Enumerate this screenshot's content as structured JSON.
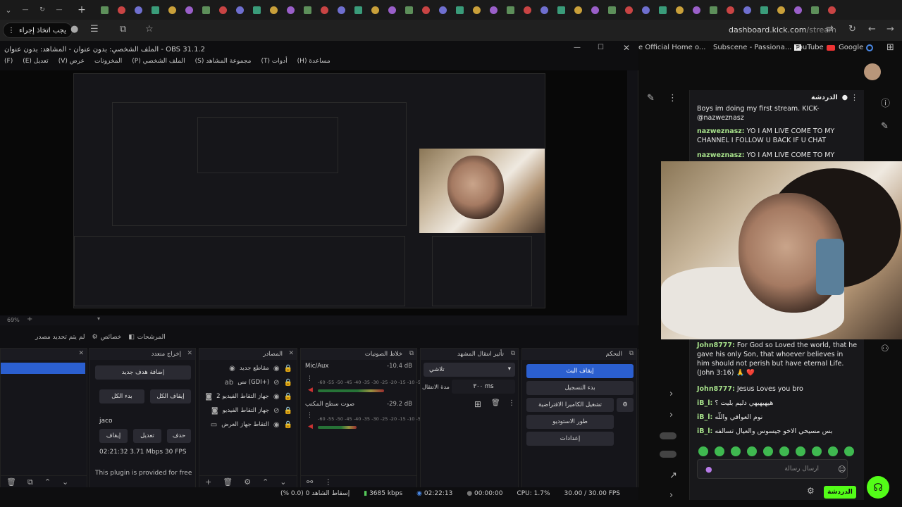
{
  "browser": {
    "tab_count": 44,
    "url_domain": "dashboard.kick.com",
    "url_path": "/stream",
    "action_button": "يجب اتخاذ إجراء",
    "bookmarks": [
      {
        "label": "e Official Home o...",
        "icon": "site-icon"
      },
      {
        "label": "Subscene - Passiona...",
        "icon": "p-icon"
      },
      {
        "label": "YouTube",
        "icon": "youtube-icon"
      },
      {
        "label": "Google",
        "icon": "google-icon"
      }
    ]
  },
  "obs": {
    "title": "الملف الشخصي: بدون عنوان - المشاهد: بدون عنوان - OBS 31.1.2",
    "menu": [
      "(F)",
      "تعديل (E)",
      "عرض (V)",
      "المخزونات",
      "الملف الشخصي (P)",
      "مجموعة المشاهد (S)",
      "أدوات (T)",
      "مساعدة (H)"
    ],
    "zoom": "69%",
    "no_source": "لم يتم تحديد مصدر",
    "properties": "خصائص",
    "filters": "المرشحات",
    "docks": {
      "output": {
        "title": "إخراج متعدد",
        "add_target": "إضافة هدف جديد",
        "start_all": "بدء الكل",
        "stop_all": "إيقاف الكل",
        "target_name": "jaco",
        "edit": "تعديل",
        "stop": "إيقاف",
        "delete": "حذف",
        "stats": "02:21:32   3.71 Mbps   30 FPS",
        "plugin_note": "This plugin is provided for free"
      },
      "sources": {
        "title": "المصادر",
        "items": [
          "مقاطع جديد",
          "نص (GDI+)",
          "جهاز التقاط الفيديو 2",
          "جهاز التقاط الفيديو",
          "التقاط جهاز العرض"
        ]
      },
      "mixer": {
        "title": "خلاط الصوتيات",
        "channels": [
          {
            "name": "Mic/Aux",
            "db": "-10.4 dB",
            "level": 0.72
          },
          {
            "name": "صوت سطح المكتب",
            "db": "-29.2 dB",
            "level": 0.42
          }
        ],
        "scale": "-60 -55 -50 -45 -40 -35 -30 -25 -20 -15 -10 -5 0"
      },
      "transition": {
        "title": "تأثير انتقال المشهد",
        "type": "تلاشي",
        "duration_label": "مدة الانتقال",
        "duration": "٣٠٠ ms"
      },
      "controls": {
        "title": "التحكم",
        "stop_stream": "إيقاف البث",
        "start_record": "بدء التسجيل",
        "virtual_cam": "تشغيل الكاميرا الافتراضية",
        "studio_mode": "طور الاستوديو",
        "settings": "إعدادات"
      }
    },
    "statusbar": {
      "dropped": "إسقاط الشاهد 0 (0.0 %)",
      "bitrate": "3685 kbps",
      "live_time": "02:22:13",
      "rec_time": "00:00:00",
      "cpu": "CPU: 1.7%",
      "fps": "30.00 / 30.00 FPS"
    }
  },
  "chat": {
    "title": "الدردشة",
    "messages": [
      {
        "user": "",
        "text": "Boys im doing my first stream. KICK-@nazweznasz"
      },
      {
        "user": "nazweznasz:",
        "text": " YO I AM LIVE COME TO MY CHANNEL I FOLLOW U BACK IF U CHAT"
      },
      {
        "user": "nazweznasz:",
        "text": " YO I AM LIVE COME TO MY"
      },
      {
        "user": "John8777:",
        "text": " For God so Loved the world, that he gave his only Son, that whoever believes in him should not perish but have eternal Life. (John 3:16) 🙏 ❤️"
      },
      {
        "user": "John8777:",
        "text": " Jesus Loves you bro"
      },
      {
        "user": "iB_l:",
        "text": " هيهيهيهي دليم بليت ؟"
      },
      {
        "user": "iB_l:",
        "text": " نوم العوافي واللّه"
      },
      {
        "user": "iB_l:",
        "text": " بس مسيحي الاخو جيسوس والعيال تسالفه"
      }
    ],
    "input_placeholder": "ارسال رسالة",
    "send_label": "الدردشة"
  },
  "colors": {
    "accent_green": "#53fc18",
    "obs_blue": "#2b5fcf",
    "chat_user": "#a6e08a"
  }
}
